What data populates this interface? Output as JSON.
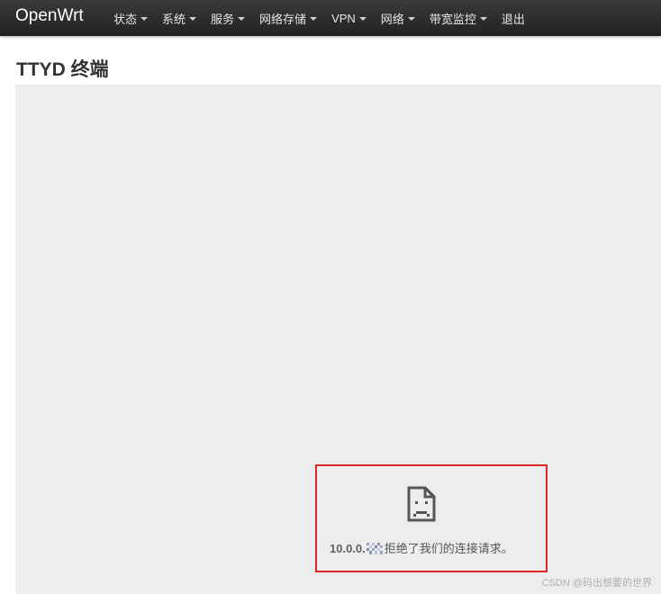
{
  "app": {
    "brand": "OpenWrt"
  },
  "nav": {
    "items": [
      {
        "label": "状态",
        "has_dropdown": true
      },
      {
        "label": "系统",
        "has_dropdown": true
      },
      {
        "label": "服务",
        "has_dropdown": true
      },
      {
        "label": "网络存储",
        "has_dropdown": true
      },
      {
        "label": "VPN",
        "has_dropdown": true
      },
      {
        "label": "网络",
        "has_dropdown": true
      },
      {
        "label": "带宽监控",
        "has_dropdown": true
      },
      {
        "label": "退出",
        "has_dropdown": false
      }
    ]
  },
  "page": {
    "title": "TTYD 终端"
  },
  "error": {
    "icon": "sad-document-icon",
    "host": "10.0.0.",
    "message": "拒绝了我们的连接请求。"
  },
  "watermark": {
    "text": "CSDN @码出想要的世界"
  },
  "colors": {
    "navbar": "#2b2b2b",
    "frame_bg": "#ededed",
    "highlight": "#e0262a"
  }
}
